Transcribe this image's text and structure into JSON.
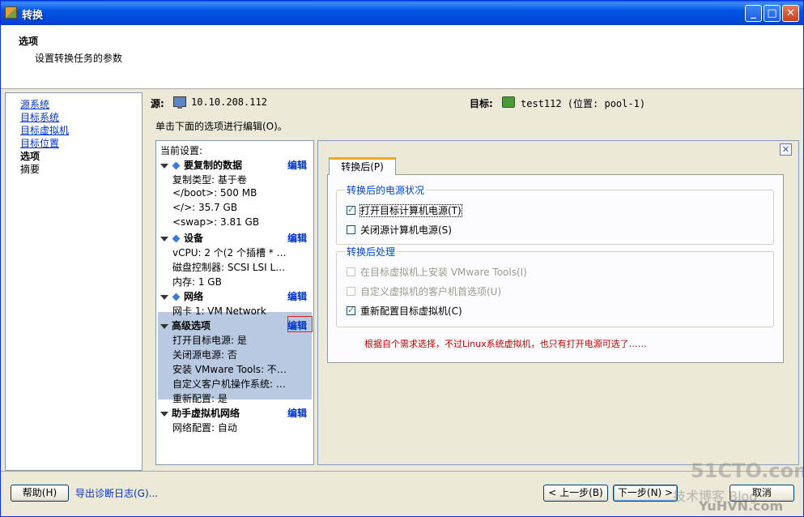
{
  "window": {
    "title": "转换"
  },
  "header": {
    "title": "选项",
    "subtitle": "设置转换任务的参数"
  },
  "nav": {
    "items": [
      {
        "label": "源系统"
      },
      {
        "label": "目标系统"
      },
      {
        "label": "目标虚拟机"
      },
      {
        "label": "目标位置"
      },
      {
        "label": "选项"
      },
      {
        "label": "摘要"
      }
    ]
  },
  "source": {
    "label": "源:",
    "value": "10.10.208.112"
  },
  "target": {
    "label": "目标:",
    "value": "test112 (位置: pool-1)"
  },
  "hint": "单击下面的选项进行编辑(O)。",
  "settings": {
    "title": "当前设置:",
    "edit_label": "编辑",
    "data": {
      "heading": "要复制的数据",
      "lines": [
        "复制类型: 基于卷",
        "</boot>: 500 MB",
        "</>: 35.7 GB",
        "<swap>: 3.81 GB"
      ]
    },
    "devices": {
      "heading": "设备",
      "lines": [
        "vCPU: 2 个(2 个插槽 * …",
        "磁盘控制器: SCSI LSI L…",
        "内存: 1 GB"
      ]
    },
    "network": {
      "heading": "网络",
      "lines": [
        "网卡 1: VM Network"
      ]
    },
    "advanced": {
      "heading": "高级选项",
      "lines": [
        "打开目标电源: 是",
        "关闭源电源: 否",
        "安装 VMware Tools: 不…",
        "自定义客户机操作系统: …",
        "重新配置: 是"
      ]
    },
    "helper": {
      "heading": "助手虚拟机网络",
      "lines": [
        "网络配置: 自动"
      ]
    }
  },
  "panel": {
    "tab_label": "转换后(P)",
    "power_group": {
      "title": "转换后的电源状况",
      "options": [
        {
          "label": "打开目标计算机电源(T)",
          "checked": true
        },
        {
          "label": "关闭源计算机电源(S)",
          "checked": false
        }
      ]
    },
    "post_group": {
      "title": "转换后处理",
      "options": [
        {
          "label": "在目标虚拟机上安装 VMware Tools(I)",
          "checked": false,
          "disabled": true
        },
        {
          "label": "自定义虚拟机的客户机首选项(U)",
          "checked": false,
          "disabled": true
        },
        {
          "label": "重新配置目标虚拟机(C)",
          "checked": true
        }
      ]
    },
    "note": "根据自个需求选择，不过Linux系统虚拟机，也只有打开电源可选了……"
  },
  "footer": {
    "help": "帮助(H)",
    "export_log": "导出诊断日志(G)...",
    "back": "< 上一步(B)",
    "next": "下一步(N) >",
    "cancel": "取消"
  },
  "watermark": {
    "line1": "51CTO.com",
    "line2": "技术博客 Blog",
    "line3": "YuHVN.com"
  }
}
